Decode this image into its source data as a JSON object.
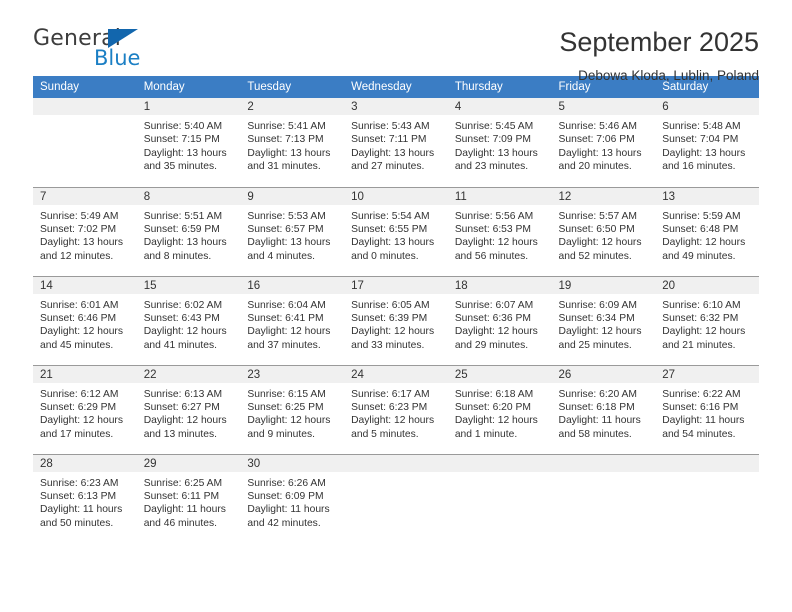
{
  "logo": {
    "word_one": "General",
    "word_two": "Blue",
    "triangle_icon": "triangle-icon",
    "accent_dark": "#1266ad",
    "accent_light": "#1b7fc4"
  },
  "header": {
    "title": "September 2025",
    "subtitle": "Debowa Kloda, Lublin, Poland"
  },
  "theme": {
    "header_blue": "#3b7dc4",
    "daynum_bg": "#f0f0f0",
    "grid_line": "#9a9a9a",
    "text": "#333333"
  },
  "weekday_headers": [
    "Sunday",
    "Monday",
    "Tuesday",
    "Wednesday",
    "Thursday",
    "Friday",
    "Saturday"
  ],
  "weeks": [
    [
      {
        "day": "",
        "sunrise": "",
        "sunset": "",
        "daylight_line1": "",
        "daylight_line2": ""
      },
      {
        "day": "1",
        "sunrise": "Sunrise: 5:40 AM",
        "sunset": "Sunset: 7:15 PM",
        "daylight_line1": "Daylight: 13 hours",
        "daylight_line2": "and 35 minutes."
      },
      {
        "day": "2",
        "sunrise": "Sunrise: 5:41 AM",
        "sunset": "Sunset: 7:13 PM",
        "daylight_line1": "Daylight: 13 hours",
        "daylight_line2": "and 31 minutes."
      },
      {
        "day": "3",
        "sunrise": "Sunrise: 5:43 AM",
        "sunset": "Sunset: 7:11 PM",
        "daylight_line1": "Daylight: 13 hours",
        "daylight_line2": "and 27 minutes."
      },
      {
        "day": "4",
        "sunrise": "Sunrise: 5:45 AM",
        "sunset": "Sunset: 7:09 PM",
        "daylight_line1": "Daylight: 13 hours",
        "daylight_line2": "and 23 minutes."
      },
      {
        "day": "5",
        "sunrise": "Sunrise: 5:46 AM",
        "sunset": "Sunset: 7:06 PM",
        "daylight_line1": "Daylight: 13 hours",
        "daylight_line2": "and 20 minutes."
      },
      {
        "day": "6",
        "sunrise": "Sunrise: 5:48 AM",
        "sunset": "Sunset: 7:04 PM",
        "daylight_line1": "Daylight: 13 hours",
        "daylight_line2": "and 16 minutes."
      }
    ],
    [
      {
        "day": "7",
        "sunrise": "Sunrise: 5:49 AM",
        "sunset": "Sunset: 7:02 PM",
        "daylight_line1": "Daylight: 13 hours",
        "daylight_line2": "and 12 minutes."
      },
      {
        "day": "8",
        "sunrise": "Sunrise: 5:51 AM",
        "sunset": "Sunset: 6:59 PM",
        "daylight_line1": "Daylight: 13 hours",
        "daylight_line2": "and 8 minutes."
      },
      {
        "day": "9",
        "sunrise": "Sunrise: 5:53 AM",
        "sunset": "Sunset: 6:57 PM",
        "daylight_line1": "Daylight: 13 hours",
        "daylight_line2": "and 4 minutes."
      },
      {
        "day": "10",
        "sunrise": "Sunrise: 5:54 AM",
        "sunset": "Sunset: 6:55 PM",
        "daylight_line1": "Daylight: 13 hours",
        "daylight_line2": "and 0 minutes."
      },
      {
        "day": "11",
        "sunrise": "Sunrise: 5:56 AM",
        "sunset": "Sunset: 6:53 PM",
        "daylight_line1": "Daylight: 12 hours",
        "daylight_line2": "and 56 minutes."
      },
      {
        "day": "12",
        "sunrise": "Sunrise: 5:57 AM",
        "sunset": "Sunset: 6:50 PM",
        "daylight_line1": "Daylight: 12 hours",
        "daylight_line2": "and 52 minutes."
      },
      {
        "day": "13",
        "sunrise": "Sunrise: 5:59 AM",
        "sunset": "Sunset: 6:48 PM",
        "daylight_line1": "Daylight: 12 hours",
        "daylight_line2": "and 49 minutes."
      }
    ],
    [
      {
        "day": "14",
        "sunrise": "Sunrise: 6:01 AM",
        "sunset": "Sunset: 6:46 PM",
        "daylight_line1": "Daylight: 12 hours",
        "daylight_line2": "and 45 minutes."
      },
      {
        "day": "15",
        "sunrise": "Sunrise: 6:02 AM",
        "sunset": "Sunset: 6:43 PM",
        "daylight_line1": "Daylight: 12 hours",
        "daylight_line2": "and 41 minutes."
      },
      {
        "day": "16",
        "sunrise": "Sunrise: 6:04 AM",
        "sunset": "Sunset: 6:41 PM",
        "daylight_line1": "Daylight: 12 hours",
        "daylight_line2": "and 37 minutes."
      },
      {
        "day": "17",
        "sunrise": "Sunrise: 6:05 AM",
        "sunset": "Sunset: 6:39 PM",
        "daylight_line1": "Daylight: 12 hours",
        "daylight_line2": "and 33 minutes."
      },
      {
        "day": "18",
        "sunrise": "Sunrise: 6:07 AM",
        "sunset": "Sunset: 6:36 PM",
        "daylight_line1": "Daylight: 12 hours",
        "daylight_line2": "and 29 minutes."
      },
      {
        "day": "19",
        "sunrise": "Sunrise: 6:09 AM",
        "sunset": "Sunset: 6:34 PM",
        "daylight_line1": "Daylight: 12 hours",
        "daylight_line2": "and 25 minutes."
      },
      {
        "day": "20",
        "sunrise": "Sunrise: 6:10 AM",
        "sunset": "Sunset: 6:32 PM",
        "daylight_line1": "Daylight: 12 hours",
        "daylight_line2": "and 21 minutes."
      }
    ],
    [
      {
        "day": "21",
        "sunrise": "Sunrise: 6:12 AM",
        "sunset": "Sunset: 6:29 PM",
        "daylight_line1": "Daylight: 12 hours",
        "daylight_line2": "and 17 minutes."
      },
      {
        "day": "22",
        "sunrise": "Sunrise: 6:13 AM",
        "sunset": "Sunset: 6:27 PM",
        "daylight_line1": "Daylight: 12 hours",
        "daylight_line2": "and 13 minutes."
      },
      {
        "day": "23",
        "sunrise": "Sunrise: 6:15 AM",
        "sunset": "Sunset: 6:25 PM",
        "daylight_line1": "Daylight: 12 hours",
        "daylight_line2": "and 9 minutes."
      },
      {
        "day": "24",
        "sunrise": "Sunrise: 6:17 AM",
        "sunset": "Sunset: 6:23 PM",
        "daylight_line1": "Daylight: 12 hours",
        "daylight_line2": "and 5 minutes."
      },
      {
        "day": "25",
        "sunrise": "Sunrise: 6:18 AM",
        "sunset": "Sunset: 6:20 PM",
        "daylight_line1": "Daylight: 12 hours",
        "daylight_line2": "and 1 minute."
      },
      {
        "day": "26",
        "sunrise": "Sunrise: 6:20 AM",
        "sunset": "Sunset: 6:18 PM",
        "daylight_line1": "Daylight: 11 hours",
        "daylight_line2": "and 58 minutes."
      },
      {
        "day": "27",
        "sunrise": "Sunrise: 6:22 AM",
        "sunset": "Sunset: 6:16 PM",
        "daylight_line1": "Daylight: 11 hours",
        "daylight_line2": "and 54 minutes."
      }
    ],
    [
      {
        "day": "28",
        "sunrise": "Sunrise: 6:23 AM",
        "sunset": "Sunset: 6:13 PM",
        "daylight_line1": "Daylight: 11 hours",
        "daylight_line2": "and 50 minutes."
      },
      {
        "day": "29",
        "sunrise": "Sunrise: 6:25 AM",
        "sunset": "Sunset: 6:11 PM",
        "daylight_line1": "Daylight: 11 hours",
        "daylight_line2": "and 46 minutes."
      },
      {
        "day": "30",
        "sunrise": "Sunrise: 6:26 AM",
        "sunset": "Sunset: 6:09 PM",
        "daylight_line1": "Daylight: 11 hours",
        "daylight_line2": "and 42 minutes."
      },
      {
        "day": "",
        "sunrise": "",
        "sunset": "",
        "daylight_line1": "",
        "daylight_line2": ""
      },
      {
        "day": "",
        "sunrise": "",
        "sunset": "",
        "daylight_line1": "",
        "daylight_line2": ""
      },
      {
        "day": "",
        "sunrise": "",
        "sunset": "",
        "daylight_line1": "",
        "daylight_line2": ""
      },
      {
        "day": "",
        "sunrise": "",
        "sunset": "",
        "daylight_line1": "",
        "daylight_line2": ""
      }
    ]
  ]
}
